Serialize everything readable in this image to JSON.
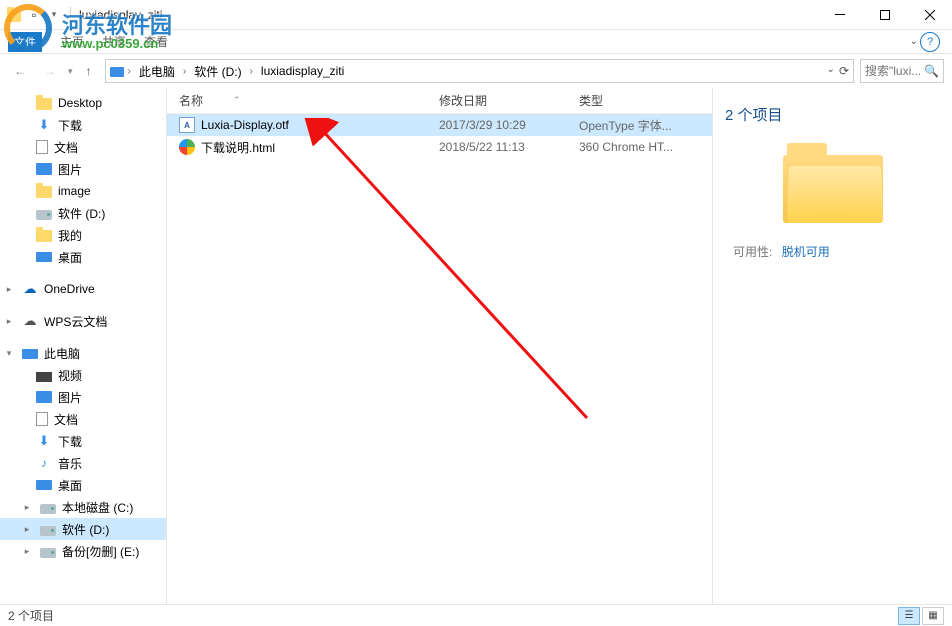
{
  "window": {
    "title": "luxiadisplay_ziti"
  },
  "ribbon": {
    "file": "文件",
    "home": "主页",
    "share": "共享",
    "view": "查看"
  },
  "breadcrumb": {
    "root": "此电脑",
    "drive": "软件 (D:)",
    "folder": "luxiadisplay_ziti"
  },
  "search": {
    "placeholder": "搜索\"luxi..."
  },
  "columns": {
    "name": "名称",
    "date": "修改日期",
    "type": "类型"
  },
  "files": [
    {
      "name": "Luxia-Display.otf",
      "date": "2017/3/29 10:29",
      "type": "OpenType 字体..."
    },
    {
      "name": "下载说明.html",
      "date": "2018/5/22 11:13",
      "type": "360 Chrome HT..."
    }
  ],
  "details": {
    "count": "2 个项目",
    "availability_label": "可用性:",
    "availability_value": "脱机可用"
  },
  "status": {
    "count": "2 个项目"
  },
  "sidebar": {
    "desktop": "Desktop",
    "downloads": "下载",
    "documents": "文档",
    "pictures": "图片",
    "image": "image",
    "software_d": "软件 (D:)",
    "my": "我的",
    "desktop2": "桌面",
    "onedrive": "OneDrive",
    "wps": "WPS云文档",
    "thispc": "此电脑",
    "video": "视频",
    "pictures2": "图片",
    "documents2": "文档",
    "downloads2": "下载",
    "music": "音乐",
    "desktop3": "桌面",
    "localdisk": "本地磁盘 (C:)",
    "software_d2": "软件 (D:)",
    "backup": "备份[勿删] (E:)"
  },
  "watermark": {
    "text": "河东软件园",
    "url": "www.pc0359.cn"
  }
}
